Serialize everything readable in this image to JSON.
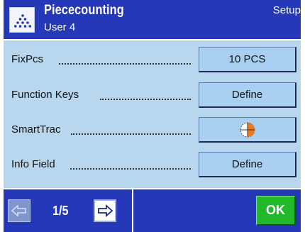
{
  "header": {
    "title": "Piececounting",
    "subtitle": "User 4",
    "mode": "Setup",
    "app_icon": "piececounting-icon"
  },
  "rows": [
    {
      "label": "FixPcs",
      "value": "10 PCS"
    },
    {
      "label": "Function Keys",
      "value": "Define"
    },
    {
      "label": "SmartTrac",
      "value": "",
      "icon": "smarttrac-icon"
    },
    {
      "label": "Info Field",
      "value": "Define"
    }
  ],
  "footer": {
    "page_indicator": "1/5",
    "prev_icon": "arrow-left-icon",
    "next_icon": "arrow-right-icon",
    "ok_label": "OK"
  },
  "colors": {
    "header_bg": "#2438b8",
    "content_bg": "#b8d7ee",
    "button_bg": "#a9d0f0",
    "ok_bg": "#22b82b",
    "smarttrac_orange": "#f07a1a"
  }
}
